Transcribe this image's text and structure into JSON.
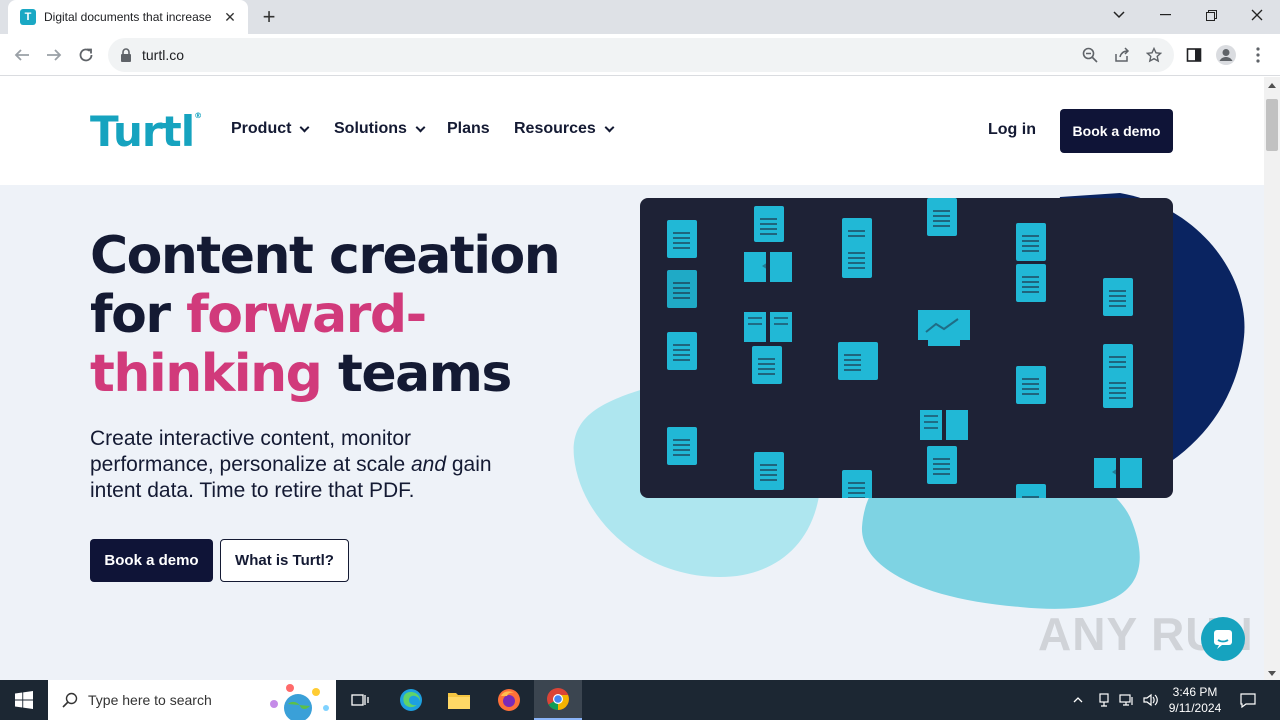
{
  "browser": {
    "tab_title": "Digital documents that increase",
    "tab_favicon": "T",
    "url": "turtl.co"
  },
  "header": {
    "logo": "Turtl",
    "nav": [
      {
        "label": "Product",
        "dropdown": true
      },
      {
        "label": "Solutions",
        "dropdown": true
      },
      {
        "label": "Plans",
        "dropdown": false
      },
      {
        "label": "Resources",
        "dropdown": true
      }
    ],
    "login_label": "Log in",
    "cta_label": "Book a demo"
  },
  "hero": {
    "line1": "Content creation",
    "line2_a": "for ",
    "line2_b": "forward-",
    "line3_a": "thinking",
    "line3_b": " teams",
    "sub_a": "Create interactive content, monitor performance, personalize at scale ",
    "sub_em": "and",
    "sub_b": " gain intent data. Time to retire that PDF.",
    "btn_primary": "Book a demo",
    "btn_secondary": "What is Turtl?"
  },
  "watermark": "ANY RUN",
  "taskbar": {
    "search_placeholder": "Type here to search",
    "time": "3:46 PM",
    "date": "9/11/2024"
  },
  "colors": {
    "brand_teal": "#16a3bf",
    "navy": "#0f1437",
    "pink": "#d13a7b",
    "hero_bg": "#eef2f8",
    "panel": "#1e2236"
  }
}
